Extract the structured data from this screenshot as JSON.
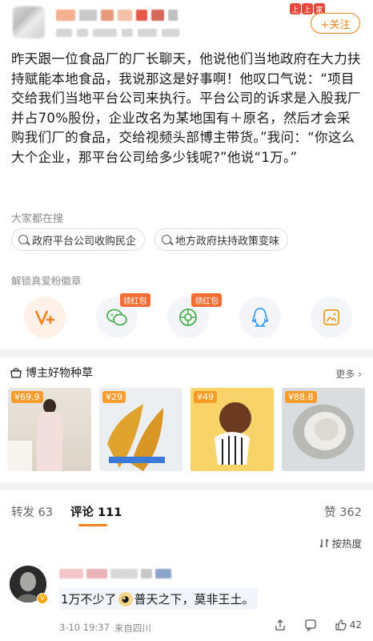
{
  "header": {
    "follow_label": "+关注",
    "badges": [
      "上",
      "上",
      "家"
    ]
  },
  "post": {
    "text": "昨天跟一位食品厂的厂长聊天，他说他们当地政府在大力扶持赋能本地食品，我说那这是好事啊！他叹口气说：“项目交给我们当地平台公司来执行。平台公司的诉求是入股我厂并占70%股份，企业改名为某地国有＋原名，然后才会采购我们厂的食品，交给视频头部博主带货。”我问：“你这么大个企业，那平台公司给多少钱呢?”他说“1万。”"
  },
  "search": {
    "title": "大家都在搜",
    "chips": [
      "政府平台公司收购民企",
      "地方政府扶持政策变味"
    ]
  },
  "fan": {
    "title": "解锁真爱粉徽章",
    "tags": [
      "领红包",
      "领红包"
    ]
  },
  "products": {
    "title": "博主好物种草",
    "more": "更多",
    "items": [
      {
        "price": "¥69.9"
      },
      {
        "price": "¥29"
      },
      {
        "price": "¥49"
      },
      {
        "price": "¥88.8"
      }
    ]
  },
  "tabs": {
    "repost": "转发 63",
    "comment": "评论 111",
    "like": "赞 362",
    "sort": "按热度"
  },
  "comment": {
    "text_a": "1万不少了",
    "text_b": "普天之下，莫非王土。",
    "date": "3-10 19:37",
    "location": "来自四川",
    "likes": "42"
  },
  "colors": {
    "accent": "#f08019",
    "price_bg": "#fa961e",
    "tag_bg": "#f36d32"
  }
}
